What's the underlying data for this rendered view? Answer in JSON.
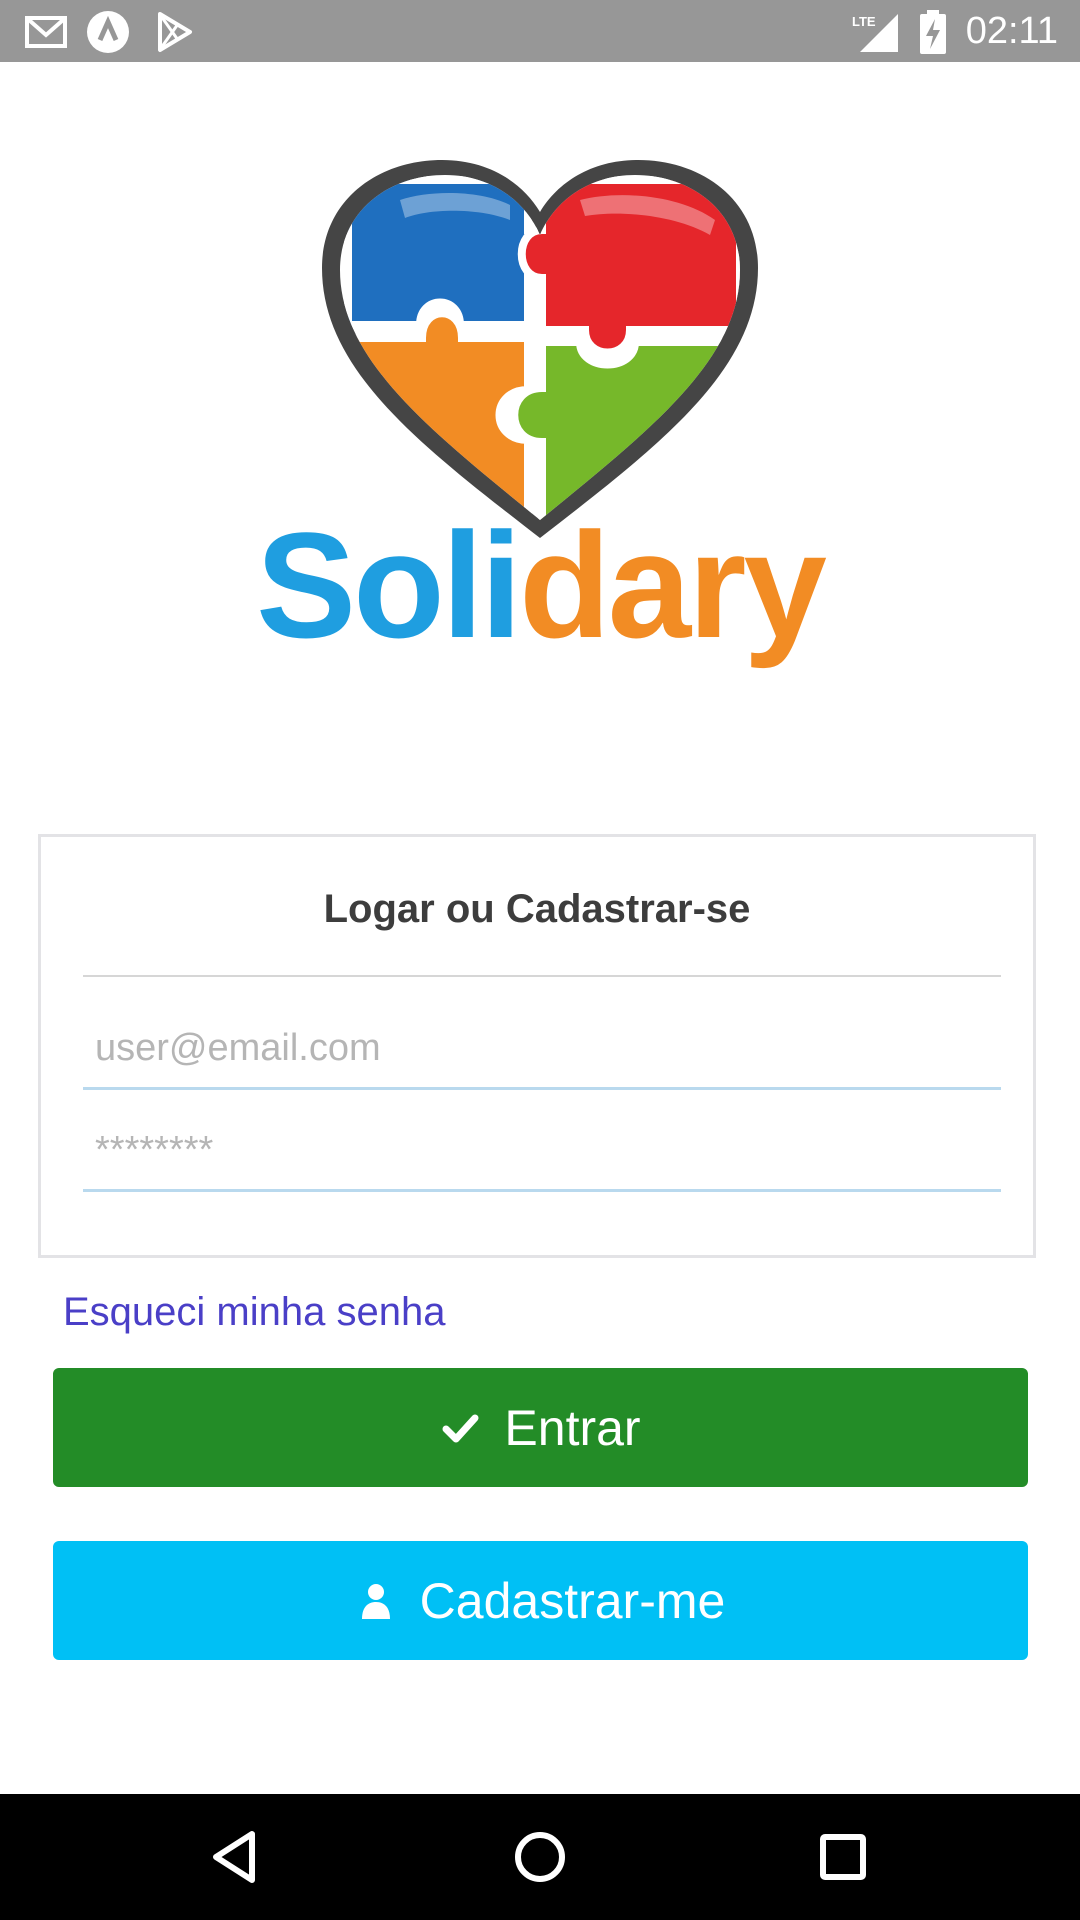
{
  "status_bar": {
    "time": "02:11",
    "icons": [
      "gmail-icon",
      "app-icon",
      "play-store-icon",
      "lte-signal-icon",
      "battery-charging-icon"
    ],
    "network_label": "LTE"
  },
  "logo": {
    "text_part1": "Soli",
    "text_part2": "dary",
    "colors": {
      "blue": "#1f9ee0",
      "orange": "#f28c24",
      "red": "#e5262b",
      "green": "#76b82a",
      "outline": "#444444"
    }
  },
  "login_card": {
    "title": "Logar ou Cadastrar-se",
    "email_placeholder": "user@email.com",
    "password_placeholder": "********"
  },
  "forgot_password": {
    "label": "Esqueci minha senha"
  },
  "buttons": {
    "login_label": "Entrar",
    "register_label": "Cadastrar-me",
    "login_color": "#238c27",
    "register_color": "#00c0f5"
  },
  "nav_bar": {
    "items": [
      "back-icon",
      "home-icon",
      "recents-icon"
    ]
  }
}
